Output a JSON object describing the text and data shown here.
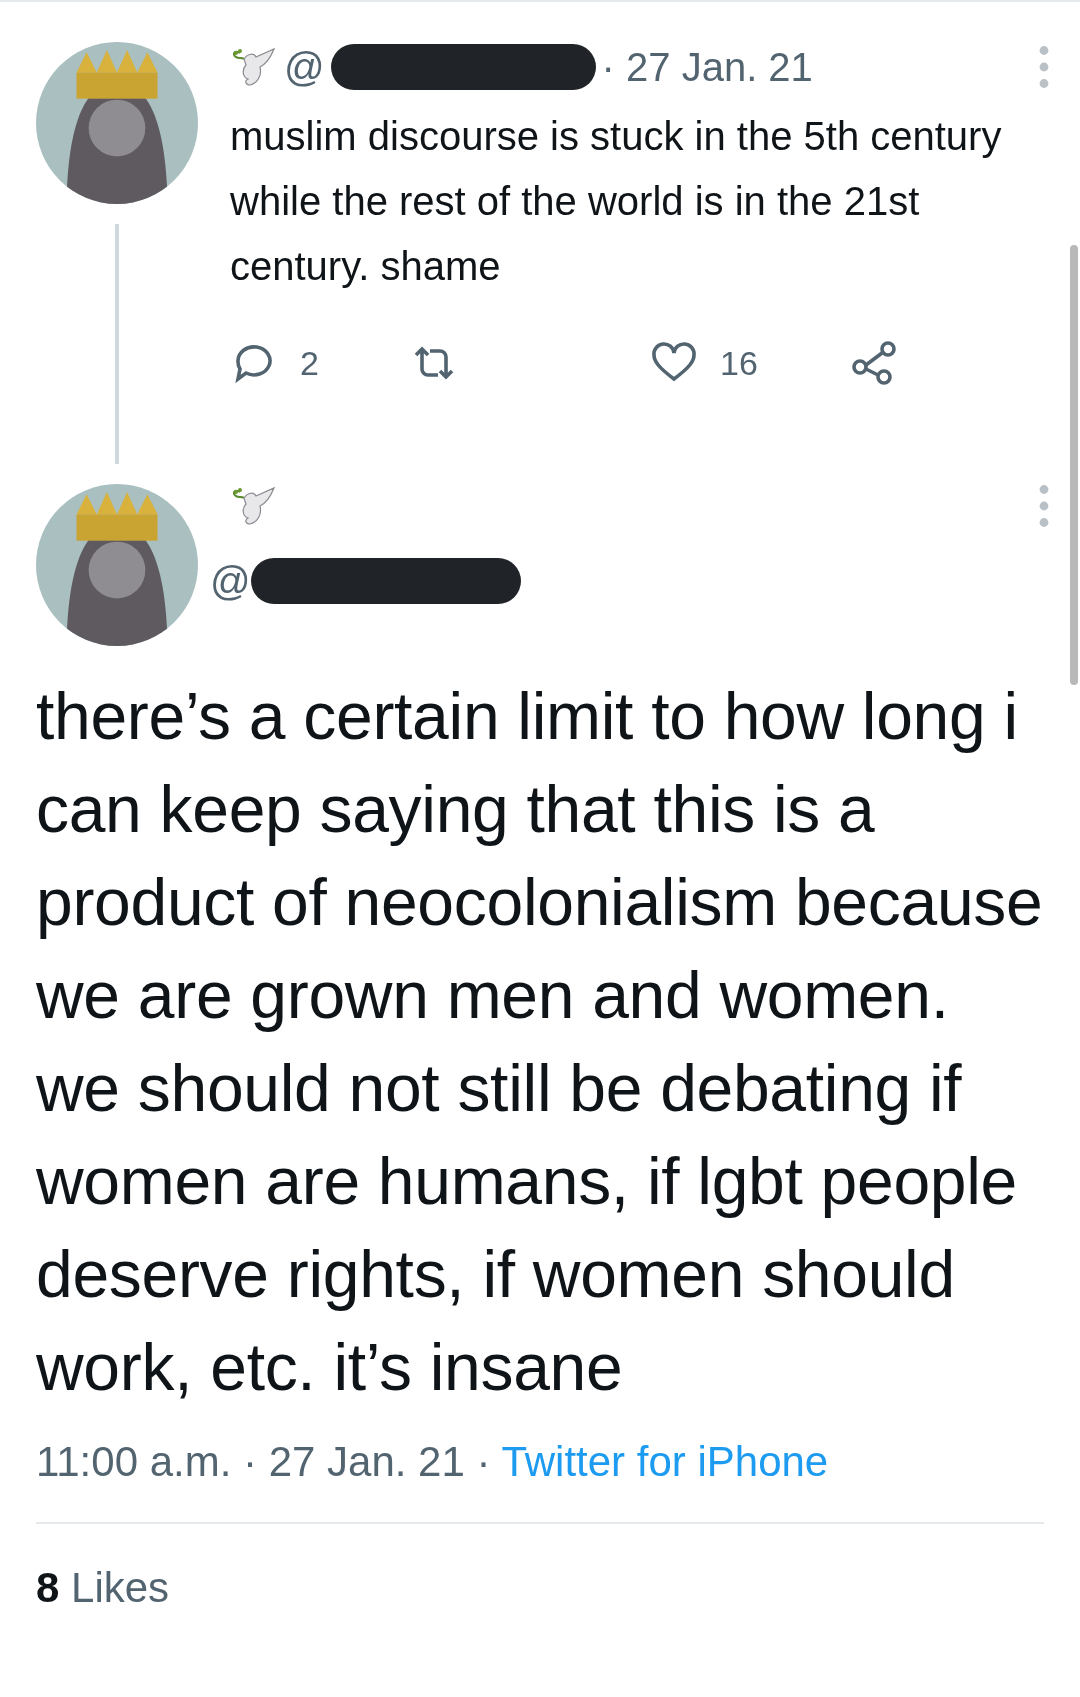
{
  "parent_tweet": {
    "handle_prefix": "@",
    "time": "· 27 Jan. 21",
    "text": "muslim discourse is stuck in the 5th century while the rest of the world is in the 21st century. shame",
    "reply_count": "2",
    "like_count": "16"
  },
  "main_tweet": {
    "handle_prefix": "@",
    "text": "there’s a certain limit to how long i can keep saying that this is a product of neocolonialism because we are grown men and women. we should not still be debating if women are humans, if lgbt people deserve rights, if women should work, etc. it’s insane",
    "time": "11:00 a.m.",
    "date": "· 27 Jan. 21 ·",
    "source": "Twitter for iPhone",
    "likes_count": "8",
    "likes_label": "Likes"
  }
}
